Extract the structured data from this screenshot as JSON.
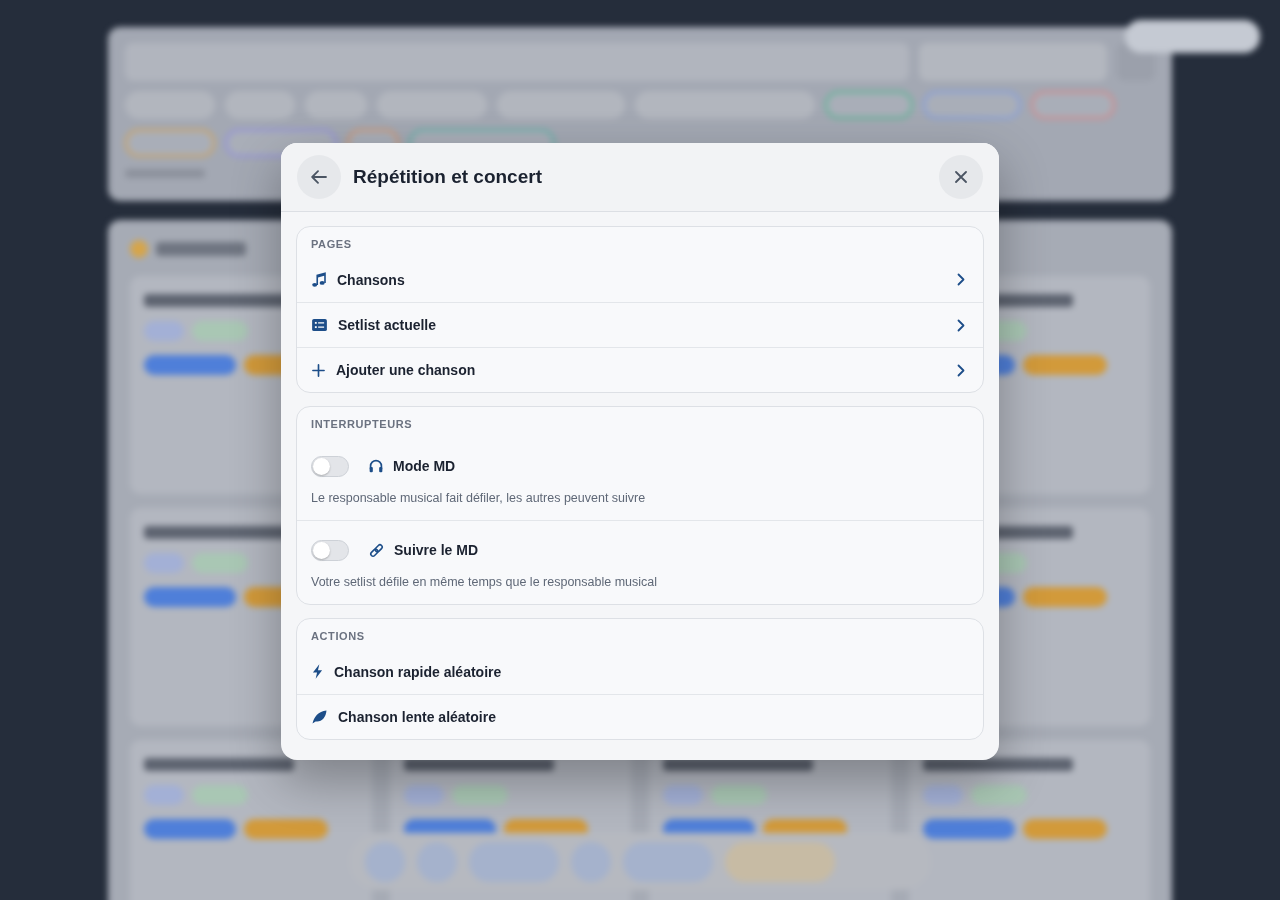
{
  "dialog": {
    "title": "Répétition et concert",
    "sections": [
      {
        "label": "PAGES",
        "items": [
          {
            "kind": "link",
            "label": "Chansons"
          },
          {
            "kind": "link",
            "label": "Setlist actuelle"
          },
          {
            "kind": "link",
            "label": "Ajouter une chanson"
          }
        ]
      },
      {
        "label": "INTERRUPTEURS",
        "items": [
          {
            "kind": "toggle",
            "label": "Mode MD",
            "on": false,
            "description": "Le responsable musical fait défiler, les autres peuvent suivre"
          },
          {
            "kind": "toggle",
            "label": "Suivre le MD",
            "on": false,
            "description": "Votre setlist défile en même temps que le responsable musical"
          }
        ]
      },
      {
        "label": "ACTIONS",
        "items": [
          {
            "kind": "action",
            "label": "Chanson rapide aléatoire"
          },
          {
            "kind": "action",
            "label": "Chanson lente aléatoire"
          }
        ]
      }
    ]
  }
}
